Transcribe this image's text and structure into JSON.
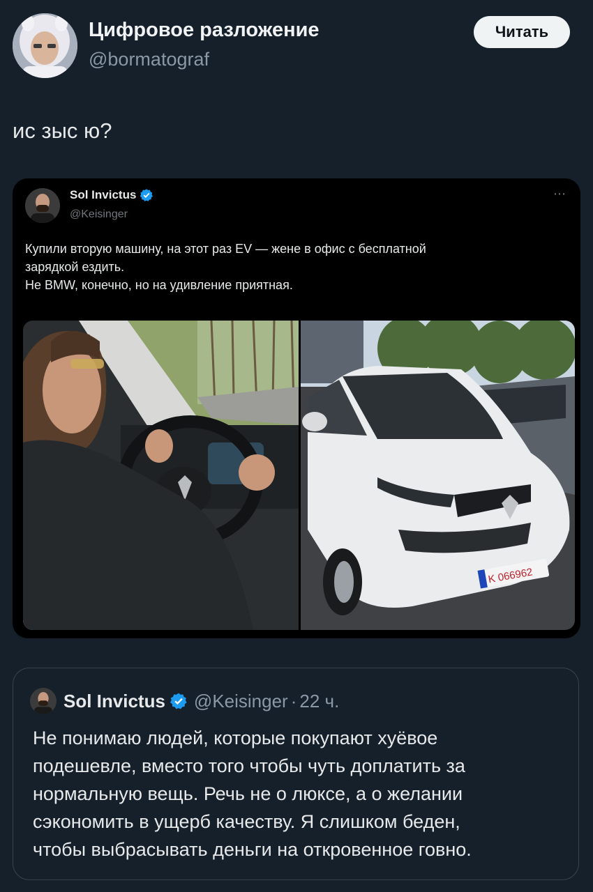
{
  "author": {
    "name": "Цифровое разложение",
    "handle": "@bormatograf",
    "follow_label": "Читать"
  },
  "post": {
    "text": "ис зыс ю?"
  },
  "embedded_screenshot": {
    "name": "Sol Invictus",
    "handle": "@Keisinger",
    "more_icon": "⋯",
    "text_lines": [
      "Купили вторую машину, на этот раз EV — жене в офис с бесплатной",
      "зарядкой ездить.",
      "Не BMW, конечно, но на удивление приятная."
    ],
    "photos": [
      {
        "subject": "man-driving-car"
      },
      {
        "subject": "white-renault-zoe",
        "plate_text": "K 066962"
      }
    ]
  },
  "quote": {
    "name": "Sol Invictus",
    "handle": "@Keisinger",
    "separator": "·",
    "time": "22 ч.",
    "text_lines": [
      "Не понимаю людей, которые покупают хуёвое",
      "подешевле, вместо того чтобы чуть доплатить за",
      "нормальную вещь. Речь не о люксе, а о желании",
      "сэкономить в ущерб качеству. Я слишком беден,",
      "чтобы выбрасывать деньги на откровенное говно."
    ]
  },
  "colors": {
    "background": "#15202b",
    "verified": "#1d9bf0",
    "secondary_text": "#8b98a5"
  }
}
